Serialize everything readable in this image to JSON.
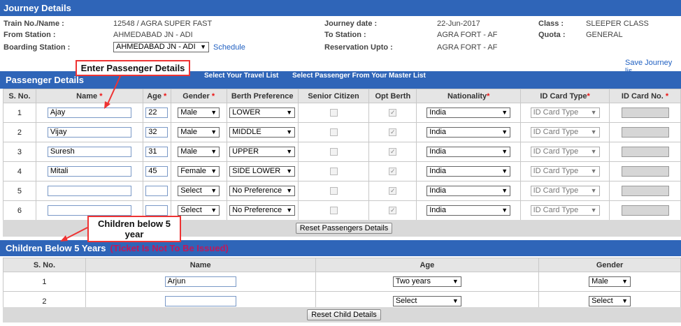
{
  "journey": {
    "title": "Journey Details",
    "train_label": "Train No./Name :",
    "train_value": "12548 / AGRA SUPER FAST",
    "from_label": "From Station :",
    "from_value": "AHMEDABAD JN - ADI",
    "boarding_label": "Boarding Station :",
    "boarding_value": "AHMEDABAD JN - ADI",
    "schedule_link": "Schedule",
    "date_label": "Journey date :",
    "date_value": "22-Jun-2017",
    "to_label": "To Station :",
    "to_value": "AGRA FORT - AF",
    "upto_label": "Reservation Upto :",
    "upto_value": "AGRA FORT - AF",
    "class_label": "Class :",
    "class_value": "SLEEPER CLASS",
    "quota_label": "Quota :",
    "quota_value": "GENERAL",
    "save_link": "Save Journey lis"
  },
  "passengers": {
    "title": "Passenger Details",
    "travel_list_link": "Select Your Travel List",
    "master_list_link": "Select Passenger From Your Master List",
    "headers": {
      "sno": "S. No.",
      "name": "Name",
      "age": "Age",
      "gender": "Gender",
      "berth": "Berth Preference",
      "senior": "Senior Citizen",
      "opt": "Opt Berth",
      "nationality": "Nationality",
      "idtype": "ID Card Type",
      "idno": "ID Card No."
    },
    "rows": [
      {
        "sno": "1",
        "name": "Ajay",
        "age": "22",
        "gender": "Male",
        "berth": "LOWER",
        "nationality": "India",
        "idtype": "ID Card Type"
      },
      {
        "sno": "2",
        "name": "Vijay",
        "age": "32",
        "gender": "Male",
        "berth": "MIDDLE",
        "nationality": "India",
        "idtype": "ID Card Type"
      },
      {
        "sno": "3",
        "name": "Suresh",
        "age": "31",
        "gender": "Male",
        "berth": "UPPER",
        "nationality": "India",
        "idtype": "ID Card Type"
      },
      {
        "sno": "4",
        "name": "Mitali",
        "age": "45",
        "gender": "Female",
        "berth": "SIDE LOWER",
        "nationality": "India",
        "idtype": "ID Card Type"
      },
      {
        "sno": "5",
        "name": "",
        "age": "",
        "gender": "Select",
        "berth": "No Preference",
        "nationality": "India",
        "idtype": "ID Card Type"
      },
      {
        "sno": "6",
        "name": "",
        "age": "",
        "gender": "Select",
        "berth": "No Preference",
        "nationality": "India",
        "idtype": "ID Card Type"
      }
    ],
    "reset_button": "Reset Passengers Details"
  },
  "children": {
    "title": "Children Below 5 Years",
    "warning": "(Ticket Is Not To Be Issued)",
    "headers": {
      "sno": "S. No.",
      "name": "Name",
      "age": "Age",
      "gender": "Gender"
    },
    "rows": [
      {
        "sno": "1",
        "name": "Arjun",
        "age": "Two years",
        "gender": "Male"
      },
      {
        "sno": "2",
        "name": "",
        "age": "Select",
        "gender": "Select"
      }
    ],
    "reset_button": "Reset Child Details"
  },
  "annotations": {
    "passenger_callout": "Enter Passenger Details",
    "children_callout": "Children below 5 year"
  },
  "colors": {
    "bar_blue": "#2f65b8",
    "callout_red": "#e33333",
    "warning_magenta": "#c2185b",
    "link_blue": "#1f5fc1"
  }
}
